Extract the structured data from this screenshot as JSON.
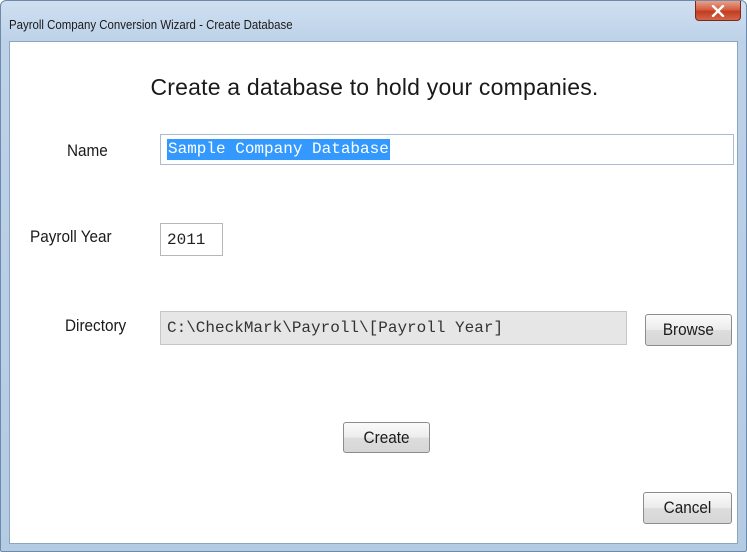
{
  "window": {
    "title": "Payroll Company Conversion Wizard - Create Database",
    "close_icon": "close-icon",
    "accent_close": "#c9472a"
  },
  "dialog": {
    "heading": "Create a database to hold your companies.",
    "name_label": "Name",
    "name_value": "Sample Company Database",
    "year_label": "Payroll Year",
    "year_value": "2011",
    "directory_label": "Directory",
    "directory_value": "C:\\CheckMark\\Payroll\\[Payroll Year]",
    "browse_label": "Browse",
    "create_label": "Create",
    "cancel_label": "Cancel",
    "selection_color": "#3399ff"
  }
}
